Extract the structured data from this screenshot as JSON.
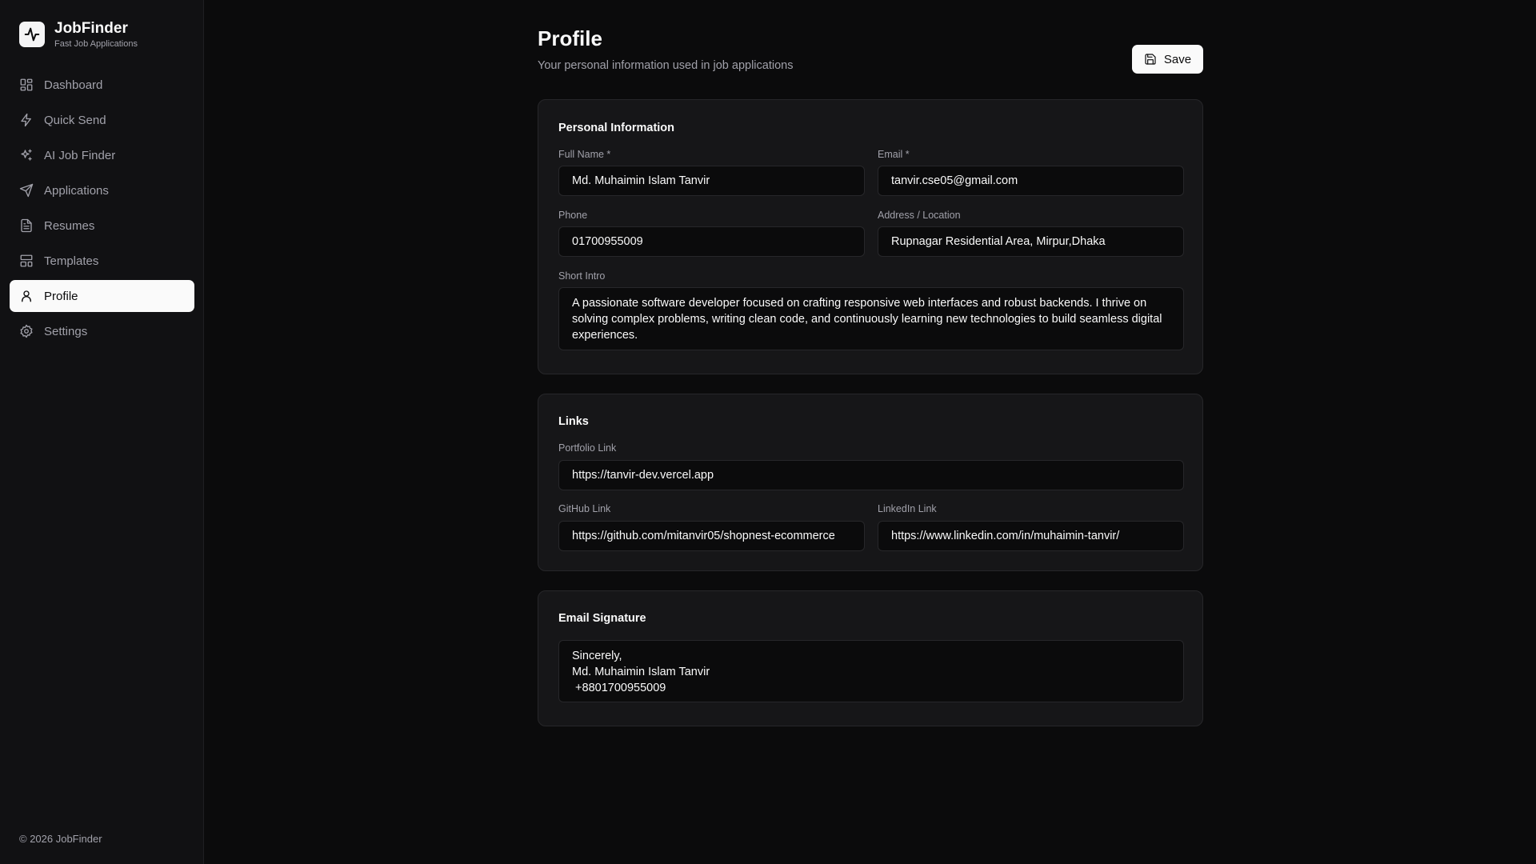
{
  "brand": {
    "name": "JobFinder",
    "tagline": "Fast Job Applications"
  },
  "sidebar": {
    "items": [
      {
        "label": "Dashboard",
        "icon": "dashboard-grid-icon"
      },
      {
        "label": "Quick Send",
        "icon": "lightning-icon"
      },
      {
        "label": "AI Job Finder",
        "icon": "sparkles-icon"
      },
      {
        "label": "Applications",
        "icon": "send-icon"
      },
      {
        "label": "Resumes",
        "icon": "document-icon"
      },
      {
        "label": "Templates",
        "icon": "layout-icon"
      },
      {
        "label": "Profile",
        "icon": "user-icon",
        "active": true
      },
      {
        "label": "Settings",
        "icon": "gear-icon"
      }
    ],
    "footer": "© 2026 JobFinder"
  },
  "header": {
    "title": "Profile",
    "subtitle": "Your personal information used in job applications",
    "save_label": "Save"
  },
  "personal": {
    "title": "Personal Information",
    "full_name_label": "Full Name *",
    "full_name": "Md. Muhaimin Islam Tanvir",
    "email_label": "Email *",
    "email": "tanvir.cse05@gmail.com",
    "phone_label": "Phone",
    "phone": "01700955009",
    "address_label": "Address / Location",
    "address": " Rupnagar Residential Area, Mirpur,Dhaka",
    "intro_label": "Short Intro",
    "intro": "A passionate software developer focused on crafting responsive web interfaces and robust backends. I thrive on solving complex problems, writing clean code, and continuously learning new technologies to build seamless digital experiences."
  },
  "links": {
    "title": "Links",
    "portfolio_label": "Portfolio Link",
    "portfolio": "https://tanvir-dev.vercel.app",
    "github_label": "GitHub Link",
    "github": "https://github.com/mitanvir05/shopnest-ecommerce",
    "linkedin_label": "LinkedIn Link",
    "linkedin": "https://www.linkedin.com/in/muhaimin-tanvir/"
  },
  "signature": {
    "title": "Email Signature",
    "text": "Sincerely,\nMd. Muhaimin Islam Tanvir\n +8801700955009"
  },
  "colors": {
    "background": "#0b0b0c",
    "card": "#161618",
    "accent": "#fafafa",
    "muted": "#a1a1aa"
  }
}
